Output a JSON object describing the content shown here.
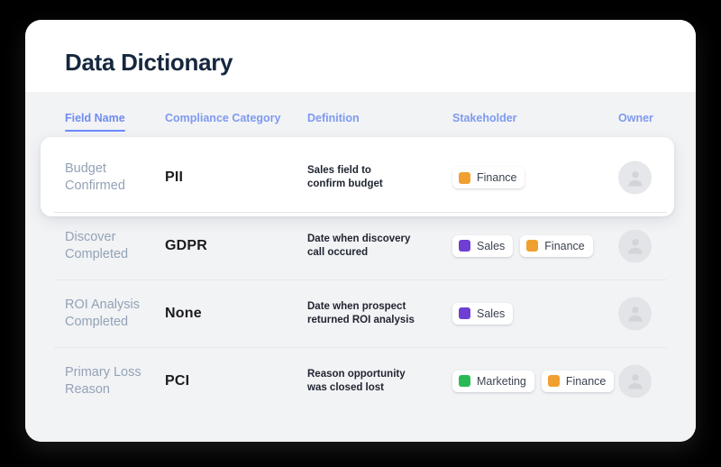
{
  "header": {
    "title": "Data Dictionary"
  },
  "table": {
    "columns": [
      {
        "key": "field_name",
        "label": "Field Name",
        "active": true
      },
      {
        "key": "compliance_category",
        "label": "Compliance Category",
        "active": false
      },
      {
        "key": "definition",
        "label": "Definition",
        "active": false
      },
      {
        "key": "stakeholder",
        "label": "Stakeholder",
        "active": false
      },
      {
        "key": "owner",
        "label": "Owner",
        "active": false
      }
    ],
    "rows": [
      {
        "field_name": "Budget\nConfirmed",
        "compliance_category": "PII",
        "definition": "Sales field to\nconfirm budget",
        "stakeholders": [
          {
            "label": "Finance",
            "color": "#f0a030"
          }
        ],
        "owner": "avatar-placeholder",
        "highlighted": true
      },
      {
        "field_name": "Discover\nCompleted",
        "compliance_category": "GDPR",
        "definition": "Date when discovery\ncall occured",
        "stakeholders": [
          {
            "label": "Sales",
            "color": "#6f3fd1"
          },
          {
            "label": "Finance",
            "color": "#f0a030"
          }
        ],
        "owner": "avatar-placeholder",
        "highlighted": false
      },
      {
        "field_name": "ROI Analysis\nCompleted",
        "compliance_category": "None",
        "definition": "Date when prospect\nreturned ROI analysis",
        "stakeholders": [
          {
            "label": "Sales",
            "color": "#6f3fd1"
          }
        ],
        "owner": "avatar-placeholder",
        "highlighted": false
      },
      {
        "field_name": "Primary Loss\nReason",
        "compliance_category": "PCI",
        "definition": "Reason opportunity\nwas closed lost",
        "stakeholders": [
          {
            "label": "Marketing",
            "color": "#2aba55"
          },
          {
            "label": "Finance",
            "color": "#f0a030"
          }
        ],
        "owner": "avatar-placeholder",
        "highlighted": false
      }
    ]
  },
  "colors": {
    "accent": "#6b8afd",
    "title": "#16273f",
    "field_name": "#93a2b6",
    "page_background": "#000000",
    "card_background": "#ffffff",
    "table_background": "#f2f3f5"
  }
}
